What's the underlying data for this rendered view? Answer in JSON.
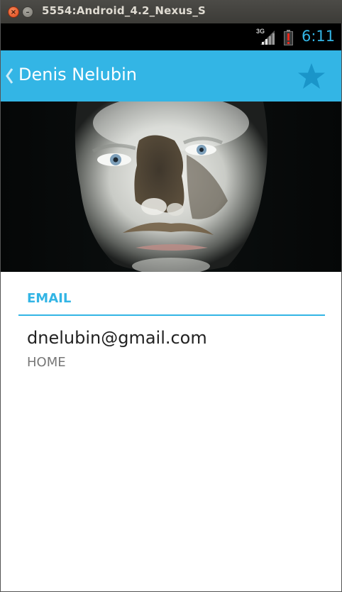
{
  "window": {
    "title": "5554:Android_4.2_Nexus_S",
    "close_glyph": "×",
    "minimize_glyph": "–"
  },
  "status_bar": {
    "network_label": "3G",
    "time": "6:11",
    "accent_color": "#33b5e5"
  },
  "action_bar": {
    "title": "Denis Nelubin",
    "background_color": "#33b5e5",
    "star_icon": "star-icon",
    "up_icon": "chevron-left-icon"
  },
  "details": {
    "email_section": {
      "header": "EMAIL",
      "entries": [
        {
          "value": "dnelubin@gmail.com",
          "type": "HOME"
        }
      ]
    }
  }
}
